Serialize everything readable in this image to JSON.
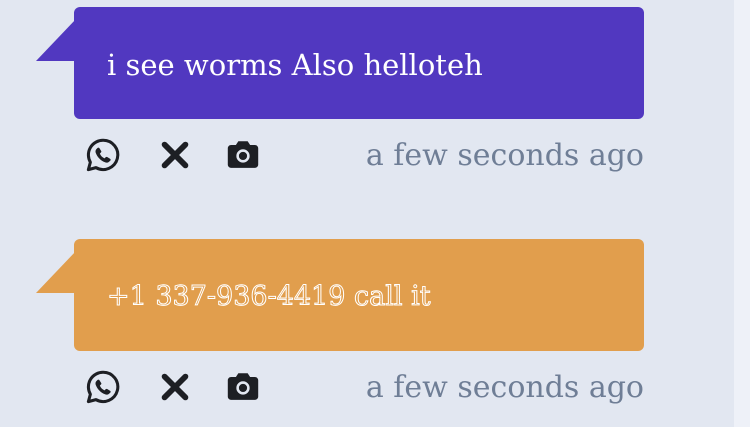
{
  "colors": {
    "background": "#e2e7f1",
    "bubble_purple": "#5138c0",
    "bubble_orange": "#e19e4d",
    "timestamp_text": "#6f7e96",
    "icon": "#1d1f24"
  },
  "messages": [
    {
      "text": "i see worms Also helloteh",
      "timestamp": "a few seconds ago",
      "actions": [
        "whatsapp-icon",
        "close-icon",
        "camera-icon"
      ]
    },
    {
      "text": "+1 337-936-4419 call it",
      "timestamp": "a few seconds ago",
      "actions": [
        "whatsapp-icon",
        "close-icon",
        "camera-icon"
      ]
    }
  ]
}
